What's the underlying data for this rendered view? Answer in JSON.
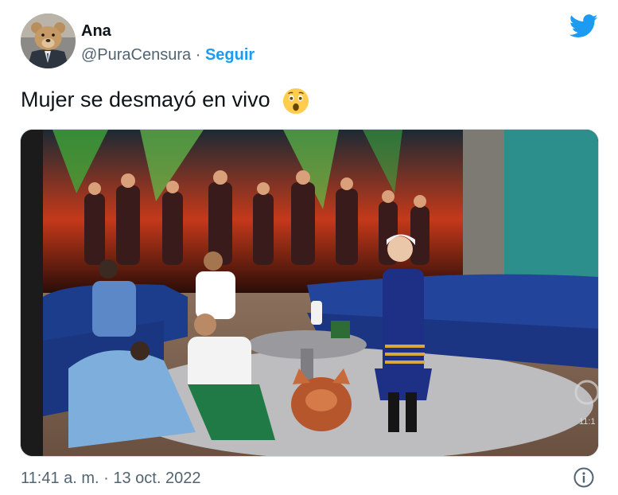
{
  "tweet": {
    "author_name": "Ana",
    "handle": "@PuraCensura",
    "separator": "·",
    "follow_label": "Seguir",
    "text": "Mujer se desmayó en vivo",
    "emoji_icon": "astonished-face-icon",
    "timestamp": "11:41 a. m. · 13 oct. 2022"
  },
  "media": {
    "description_icon": "video-still-tv-show-set",
    "corner_mark": "11:1"
  },
  "colors": {
    "brand_blue": "#1d9bf0",
    "text_primary": "#0f1419",
    "text_secondary": "#536471"
  }
}
